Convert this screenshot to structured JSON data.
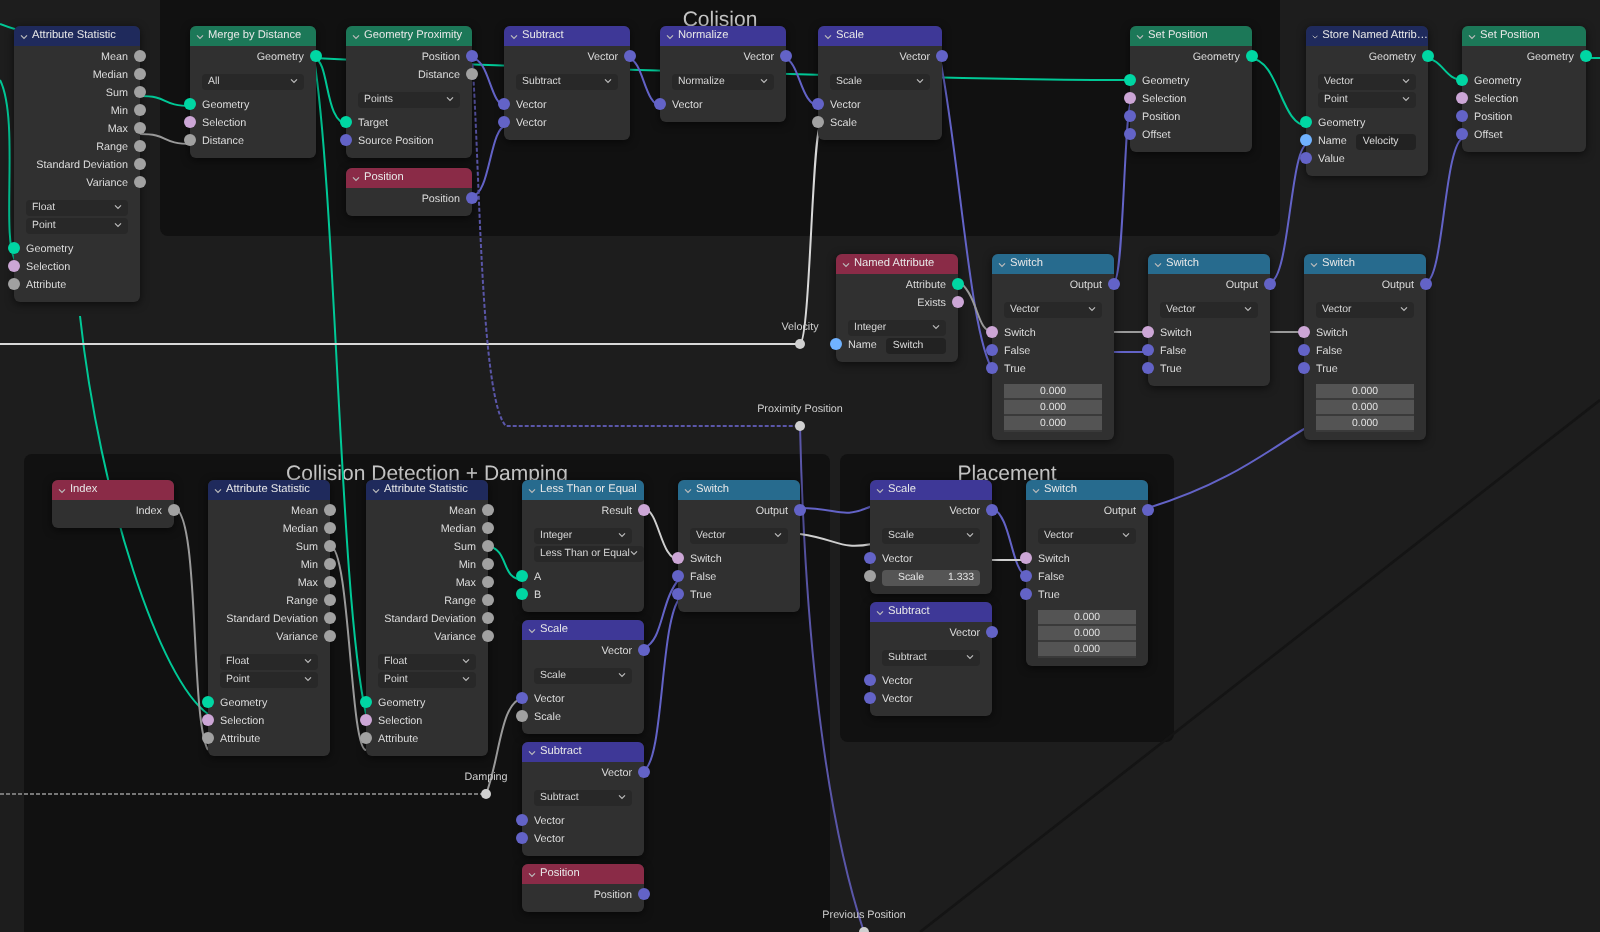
{
  "frames": [
    {
      "title": "Colision"
    },
    {
      "title": "Collision Detection + Damping"
    },
    {
      "title": "Placement"
    }
  ],
  "nodes": [
    {
      "title": "Attribute Statistic",
      "color": "#1f2a5c",
      "rows": [
        {
          "kind": "output",
          "label": "Mean",
          "color": "#a1a1a1"
        },
        {
          "kind": "output",
          "label": "Median",
          "color": "#a1a1a1"
        },
        {
          "kind": "output",
          "label": "Sum",
          "color": "#a1a1a1"
        },
        {
          "kind": "output",
          "label": "Min",
          "color": "#a1a1a1"
        },
        {
          "kind": "output",
          "label": "Max",
          "color": "#a1a1a1"
        },
        {
          "kind": "output",
          "label": "Range",
          "color": "#a1a1a1"
        },
        {
          "kind": "output",
          "label": "Standard Deviation",
          "color": "#a1a1a1"
        },
        {
          "kind": "output",
          "label": "Variance",
          "color": "#a1a1a1"
        },
        {
          "kind": "dropdown",
          "label": "Float"
        },
        {
          "kind": "dropdown",
          "label": "Point"
        },
        {
          "kind": "input",
          "label": "Geometry",
          "color": "#00d6a3"
        },
        {
          "kind": "input",
          "label": "Selection",
          "color": "#cca6d6"
        },
        {
          "kind": "input",
          "label": "Attribute",
          "color": "#a1a1a1"
        }
      ]
    },
    {
      "title": "Merge by Distance",
      "color": "#1c7858",
      "rows": [
        {
          "kind": "output",
          "label": "Geometry",
          "color": "#00d6a3"
        },
        {
          "kind": "dropdown",
          "label": "All"
        },
        {
          "kind": "input",
          "label": "Geometry",
          "color": "#00d6a3"
        },
        {
          "kind": "input",
          "label": "Selection",
          "color": "#cca6d6"
        },
        {
          "kind": "input",
          "label": "Distance",
          "color": "#a1a1a1"
        }
      ]
    },
    {
      "title": "Geometry Proximity",
      "color": "#1c7858",
      "rows": [
        {
          "kind": "output",
          "label": "Position",
          "color": "#6363c7"
        },
        {
          "kind": "output",
          "label": "Distance",
          "color": "#a1a1a1"
        },
        {
          "kind": "dropdown",
          "label": "Points"
        },
        {
          "kind": "input",
          "label": "Target",
          "color": "#00d6a3"
        },
        {
          "kind": "input",
          "label": "Source Position",
          "color": "#6363c7"
        }
      ]
    },
    {
      "title": "Position",
      "color": "#8a2b47",
      "rows": [
        {
          "kind": "output",
          "label": "Position",
          "color": "#6363c7"
        }
      ]
    },
    {
      "title": "Subtract",
      "color": "#3e3897",
      "rows": [
        {
          "kind": "output",
          "label": "Vector",
          "color": "#6363c7"
        },
        {
          "kind": "dropdown",
          "label": "Subtract"
        },
        {
          "kind": "input",
          "label": "Vector",
          "color": "#6363c7"
        },
        {
          "kind": "input",
          "label": "Vector",
          "color": "#6363c7"
        }
      ]
    },
    {
      "title": "Normalize",
      "color": "#3e3897",
      "rows": [
        {
          "kind": "output",
          "label": "Vector",
          "color": "#6363c7"
        },
        {
          "kind": "dropdown",
          "label": "Normalize"
        },
        {
          "kind": "input",
          "label": "Vector",
          "color": "#6363c7"
        }
      ]
    },
    {
      "title": "Scale",
      "color": "#3e3897",
      "rows": [
        {
          "kind": "output",
          "label": "Vector",
          "color": "#6363c7"
        },
        {
          "kind": "dropdown",
          "label": "Scale"
        },
        {
          "kind": "input",
          "label": "Vector",
          "color": "#6363c7"
        },
        {
          "kind": "input",
          "label": "Scale",
          "color": "#a1a1a1"
        }
      ]
    },
    {
      "title": "Set Position",
      "color": "#1c7858",
      "rows": [
        {
          "kind": "output",
          "label": "Geometry",
          "color": "#00d6a3"
        },
        {
          "kind": "input",
          "label": "Geometry",
          "color": "#00d6a3"
        },
        {
          "kind": "input",
          "label": "Selection",
          "color": "#cca6d6"
        },
        {
          "kind": "input",
          "label": "Position",
          "color": "#6363c7"
        },
        {
          "kind": "input",
          "label": "Offset",
          "color": "#6363c7"
        }
      ]
    },
    {
      "title": "Store Named Attrib…",
      "color": "#1f2a5c",
      "rows": [
        {
          "kind": "output",
          "label": "Geometry",
          "color": "#00d6a3"
        },
        {
          "kind": "dropdown",
          "label": "Vector"
        },
        {
          "kind": "dropdown",
          "label": "Point"
        },
        {
          "kind": "input",
          "label": "Geometry",
          "color": "#00d6a3"
        },
        {
          "kind": "field",
          "label": "Name",
          "value": "Velocity",
          "color": "#70b2ff"
        },
        {
          "kind": "input",
          "label": "Value",
          "color": "#6363c7"
        }
      ]
    },
    {
      "title": "Set Position",
      "color": "#1c7858",
      "rows": [
        {
          "kind": "output",
          "label": "Geometry",
          "color": "#00d6a3"
        },
        {
          "kind": "input",
          "label": "Geometry",
          "color": "#00d6a3"
        },
        {
          "kind": "input",
          "label": "Selection",
          "color": "#cca6d6"
        },
        {
          "kind": "input",
          "label": "Position",
          "color": "#6363c7"
        },
        {
          "kind": "input",
          "label": "Offset",
          "color": "#6363c7"
        }
      ]
    },
    {
      "title": "Named Attribute",
      "color": "#8a2b47",
      "rows": [
        {
          "kind": "output",
          "label": "Attribute",
          "color": "#00d6a3"
        },
        {
          "kind": "output",
          "label": "Exists",
          "color": "#cca6d6"
        },
        {
          "kind": "dropdown",
          "label": "Integer"
        },
        {
          "kind": "field",
          "label": "Name",
          "value": "Switch",
          "color": "#70b2ff"
        }
      ]
    },
    {
      "title": "Switch",
      "color": "#276b8e",
      "rows": [
        {
          "kind": "output",
          "label": "Output",
          "color": "#6363c7"
        },
        {
          "kind": "dropdown",
          "label": "Vector"
        },
        {
          "kind": "input",
          "label": "Switch",
          "color": "#cca6d6"
        },
        {
          "kind": "input",
          "label": "False",
          "color": "#6363c7"
        },
        {
          "kind": "input",
          "label": "True",
          "color": "#6363c7"
        },
        {
          "kind": "value",
          "label": "0.000"
        },
        {
          "kind": "value",
          "label": "0.000"
        },
        {
          "kind": "value",
          "label": "0.000"
        }
      ]
    },
    {
      "title": "Switch",
      "color": "#276b8e",
      "rows": [
        {
          "kind": "output",
          "label": "Output",
          "color": "#6363c7"
        },
        {
          "kind": "dropdown",
          "label": "Vector"
        },
        {
          "kind": "input",
          "label": "Switch",
          "color": "#cca6d6"
        },
        {
          "kind": "input",
          "label": "False",
          "color": "#6363c7"
        },
        {
          "kind": "input",
          "label": "True",
          "color": "#6363c7"
        }
      ]
    },
    {
      "title": "Switch",
      "color": "#276b8e",
      "rows": [
        {
          "kind": "output",
          "label": "Output",
          "color": "#6363c7"
        },
        {
          "kind": "dropdown",
          "label": "Vector"
        },
        {
          "kind": "input",
          "label": "Switch",
          "color": "#cca6d6"
        },
        {
          "kind": "input",
          "label": "False",
          "color": "#6363c7"
        },
        {
          "kind": "input",
          "label": "True",
          "color": "#6363c7"
        },
        {
          "kind": "value",
          "label": "0.000"
        },
        {
          "kind": "value",
          "label": "0.000"
        },
        {
          "kind": "value",
          "label": "0.000"
        }
      ]
    },
    {
      "title": "Index",
      "color": "#8a2b47",
      "rows": [
        {
          "kind": "output",
          "label": "Index",
          "color": "#a1a1a1"
        }
      ]
    },
    {
      "title": "Attribute Statistic",
      "color": "#1f2a5c",
      "rows": [
        {
          "kind": "output",
          "label": "Mean",
          "color": "#a1a1a1"
        },
        {
          "kind": "output",
          "label": "Median",
          "color": "#a1a1a1"
        },
        {
          "kind": "output",
          "label": "Sum",
          "color": "#a1a1a1"
        },
        {
          "kind": "output",
          "label": "Min",
          "color": "#a1a1a1"
        },
        {
          "kind": "output",
          "label": "Max",
          "color": "#a1a1a1"
        },
        {
          "kind": "output",
          "label": "Range",
          "color": "#a1a1a1"
        },
        {
          "kind": "output",
          "label": "Standard Deviation",
          "color": "#a1a1a1"
        },
        {
          "kind": "output",
          "label": "Variance",
          "color": "#a1a1a1"
        },
        {
          "kind": "dropdown",
          "label": "Float"
        },
        {
          "kind": "dropdown",
          "label": "Point"
        },
        {
          "kind": "input",
          "label": "Geometry",
          "color": "#00d6a3"
        },
        {
          "kind": "input",
          "label": "Selection",
          "color": "#cca6d6"
        },
        {
          "kind": "input",
          "label": "Attribute",
          "color": "#a1a1a1"
        }
      ]
    },
    {
      "title": "Attribute Statistic",
      "color": "#1f2a5c",
      "rows": [
        {
          "kind": "output",
          "label": "Mean",
          "color": "#a1a1a1"
        },
        {
          "kind": "output",
          "label": "Median",
          "color": "#a1a1a1"
        },
        {
          "kind": "output",
          "label": "Sum",
          "color": "#a1a1a1"
        },
        {
          "kind": "output",
          "label": "Min",
          "color": "#a1a1a1"
        },
        {
          "kind": "output",
          "label": "Max",
          "color": "#a1a1a1"
        },
        {
          "kind": "output",
          "label": "Range",
          "color": "#a1a1a1"
        },
        {
          "kind": "output",
          "label": "Standard Deviation",
          "color": "#a1a1a1"
        },
        {
          "kind": "output",
          "label": "Variance",
          "color": "#a1a1a1"
        },
        {
          "kind": "dropdown",
          "label": "Float"
        },
        {
          "kind": "dropdown",
          "label": "Point"
        },
        {
          "kind": "input",
          "label": "Geometry",
          "color": "#00d6a3"
        },
        {
          "kind": "input",
          "label": "Selection",
          "color": "#cca6d6"
        },
        {
          "kind": "input",
          "label": "Attribute",
          "color": "#a1a1a1"
        }
      ]
    },
    {
      "title": "Less Than or Equal",
      "color": "#276b8e",
      "rows": [
        {
          "kind": "output",
          "label": "Result",
          "color": "#cca6d6"
        },
        {
          "kind": "dropdown",
          "label": "Integer"
        },
        {
          "kind": "dropdown",
          "label": "Less Than or Equal"
        },
        {
          "kind": "input",
          "label": "A",
          "color": "#00d6a3"
        },
        {
          "kind": "input",
          "label": "B",
          "color": "#00d6a3"
        }
      ]
    },
    {
      "title": "Scale",
      "color": "#3e3897",
      "rows": [
        {
          "kind": "output",
          "label": "Vector",
          "color": "#6363c7"
        },
        {
          "kind": "dropdown",
          "label": "Scale"
        },
        {
          "kind": "input",
          "label": "Vector",
          "color": "#6363c7"
        },
        {
          "kind": "input",
          "label": "Scale",
          "color": "#a1a1a1"
        }
      ]
    },
    {
      "title": "Subtract",
      "color": "#3e3897",
      "rows": [
        {
          "kind": "output",
          "label": "Vector",
          "color": "#6363c7"
        },
        {
          "kind": "dropdown",
          "label": "Subtract"
        },
        {
          "kind": "input",
          "label": "Vector",
          "color": "#6363c7"
        },
        {
          "kind": "input",
          "label": "Vector",
          "color": "#6363c7"
        }
      ]
    },
    {
      "title": "Position",
      "color": "#8a2b47",
      "rows": [
        {
          "kind": "output",
          "label": "Position",
          "color": "#6363c7"
        }
      ]
    },
    {
      "title": "Switch",
      "color": "#276b8e",
      "rows": [
        {
          "kind": "output",
          "label": "Output",
          "color": "#6363c7"
        },
        {
          "kind": "dropdown",
          "label": "Vector"
        },
        {
          "kind": "input",
          "label": "Switch",
          "color": "#cca6d6"
        },
        {
          "kind": "input",
          "label": "False",
          "color": "#6363c7"
        },
        {
          "kind": "input",
          "label": "True",
          "color": "#6363c7"
        }
      ]
    },
    {
      "title": "Scale",
      "color": "#3e3897",
      "rows": [
        {
          "kind": "output",
          "label": "Vector",
          "color": "#6363c7"
        },
        {
          "kind": "dropdown",
          "label": "Scale"
        },
        {
          "kind": "input",
          "label": "Vector",
          "color": "#6363c7"
        },
        {
          "kind": "slider",
          "label": "Scale",
          "value": "1.333",
          "color": "#a1a1a1"
        }
      ]
    },
    {
      "title": "Subtract",
      "color": "#3e3897",
      "rows": [
        {
          "kind": "output",
          "label": "Vector",
          "color": "#6363c7"
        },
        {
          "kind": "dropdown",
          "label": "Subtract"
        },
        {
          "kind": "input",
          "label": "Vector",
          "color": "#6363c7"
        },
        {
          "kind": "input",
          "label": "Vector",
          "color": "#6363c7"
        }
      ]
    },
    {
      "title": "Switch",
      "color": "#276b8e",
      "rows": [
        {
          "kind": "output",
          "label": "Output",
          "color": "#6363c7"
        },
        {
          "kind": "dropdown",
          "label": "Vector"
        },
        {
          "kind": "input",
          "label": "Switch",
          "color": "#cca6d6"
        },
        {
          "kind": "input",
          "label": "False",
          "color": "#6363c7"
        },
        {
          "kind": "input",
          "label": "True",
          "color": "#6363c7"
        },
        {
          "kind": "value",
          "label": "0.000"
        },
        {
          "kind": "value",
          "label": "0.000"
        },
        {
          "kind": "value",
          "label": "0.000"
        }
      ]
    }
  ],
  "reroutes": [
    {
      "label": "Velocity"
    },
    {
      "label": "Proximity Position"
    },
    {
      "label": "Damping"
    },
    {
      "label": "Previous Position"
    }
  ]
}
